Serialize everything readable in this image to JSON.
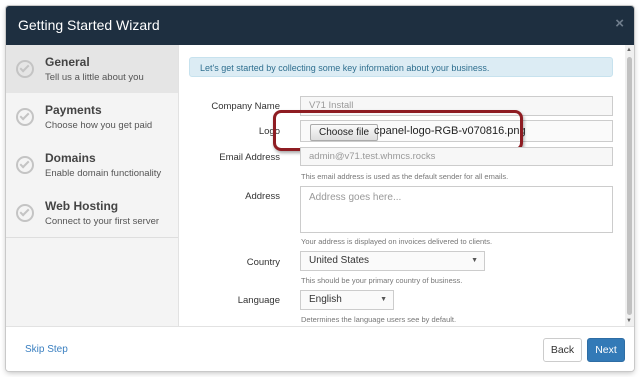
{
  "header": {
    "title": "Getting Started Wizard",
    "close": "×"
  },
  "sidebar": {
    "steps": [
      {
        "title": "General",
        "desc": "Tell us a little about you"
      },
      {
        "title": "Payments",
        "desc": "Choose how you get paid"
      },
      {
        "title": "Domains",
        "desc": "Enable domain functionality"
      },
      {
        "title": "Web Hosting",
        "desc": "Connect to your first server"
      }
    ]
  },
  "form": {
    "info": "Let's get started by collecting some key information about your business.",
    "company_label": "Company Name",
    "company_value": "V71 Install",
    "logo_label": "Logo",
    "logo_button": "Choose file",
    "logo_file": "cpanel-logo-RGB-v070816.png",
    "email_label": "Email Address",
    "email_value": "admin@v71.test.whmcs.rocks",
    "email_help": "This email address is used as the default sender for all emails.",
    "address_label": "Address",
    "address_placeholder": "Address goes here...",
    "address_help": "Your address is displayed on invoices delivered to clients.",
    "country_label": "Country",
    "country_value": "United States",
    "country_help": "This should be your primary country of business.",
    "language_label": "Language",
    "language_value": "English",
    "language_help": "Determines the language users see by default."
  },
  "footer": {
    "skip": "Skip Step",
    "back": "Back",
    "next": "Next"
  },
  "colors": {
    "header_bg": "#1e2f40",
    "primary_button": "#337ab7",
    "callout": "#8e1c22",
    "info_bg": "#dcecf4"
  }
}
